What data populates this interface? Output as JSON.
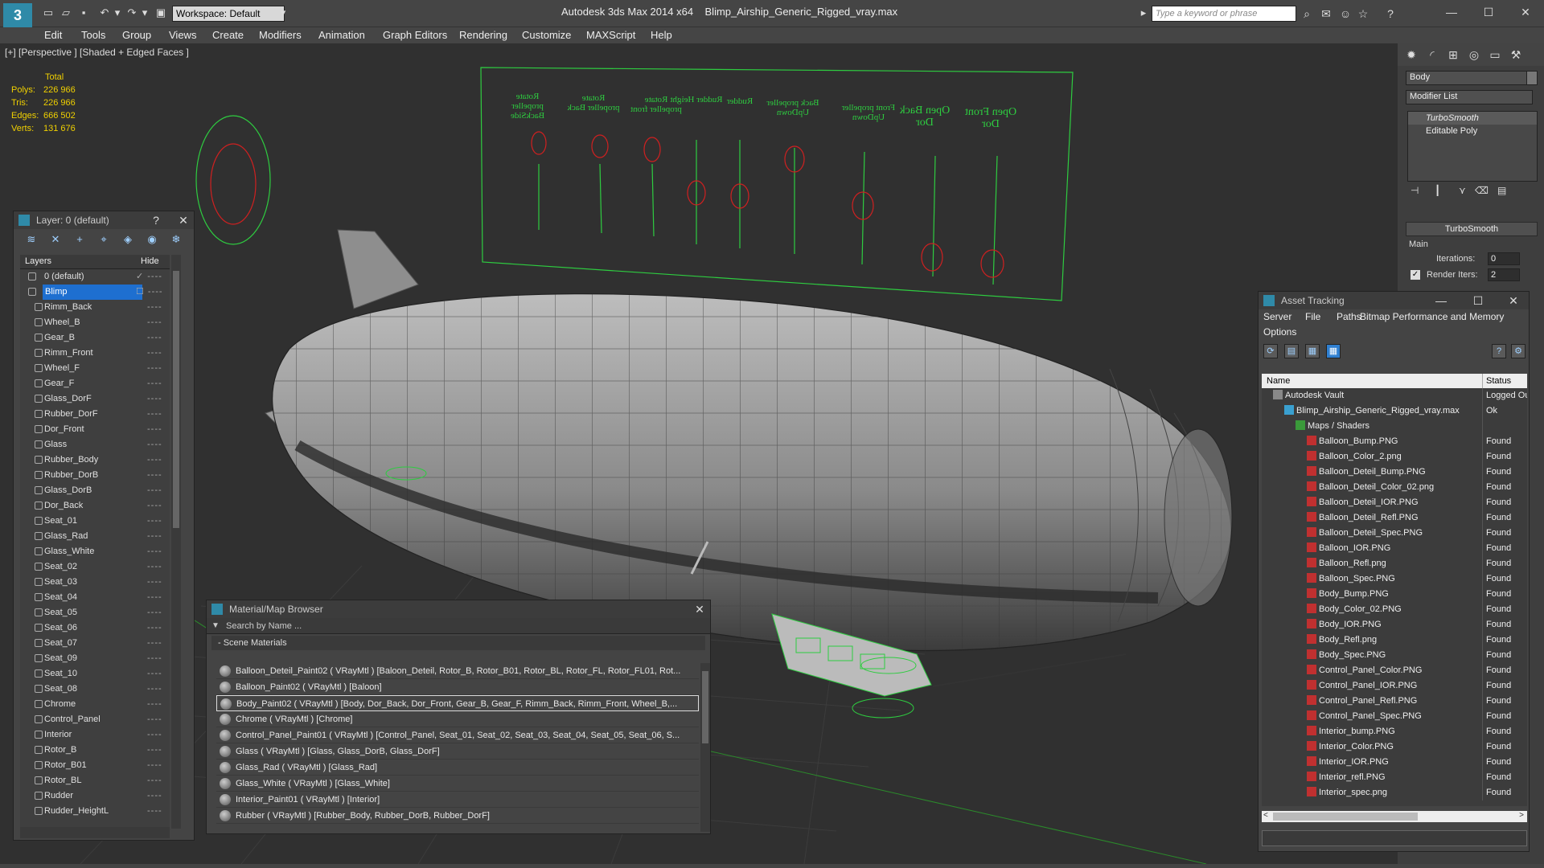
{
  "app": {
    "title": "Autodesk 3ds Max  2014 x64",
    "file": "Blimp_Airship_Generic_Rigged_vray.max",
    "workspace": "Workspace: Default",
    "search_placeholder": "Type a keyword or phrase",
    "logo": "3"
  },
  "menu": [
    "Edit",
    "Tools",
    "Group",
    "Views",
    "Create",
    "Modifiers",
    "Animation",
    "Graph Editors",
    "Rendering",
    "Customize",
    "MAXScript",
    "Help"
  ],
  "viewport": {
    "label": "[+] [Perspective ] [Shaded + Edged Faces ]",
    "stats": {
      "header": "Total",
      "rows": [
        {
          "label": "Polys:",
          "value": "226 966"
        },
        {
          "label": "Tris:",
          "value": "226 966"
        },
        {
          "label": "Edges:",
          "value": "666 502"
        },
        {
          "label": "Verts:",
          "value": "131 676"
        }
      ]
    },
    "control_labels": [
      "Rotate propeller BackSide",
      "Rotate propeller Back",
      "Rotate propeller front",
      "Rudder Height",
      "Rudder",
      "Back propeller UpDown",
      "Front propeller UpDown",
      "Open Back Dor",
      "Open Front Dor"
    ]
  },
  "layer_panel": {
    "title": "Layer: 0 (default)",
    "help": "?",
    "close": "✕",
    "col_layers": "Layers",
    "col_hide": "Hide",
    "rows": [
      {
        "name": "0 (default)",
        "top": true
      },
      {
        "name": "Blimp",
        "selected": true
      },
      {
        "name": "Rimm_Back"
      },
      {
        "name": "Wheel_B"
      },
      {
        "name": "Gear_B"
      },
      {
        "name": "Rimm_Front"
      },
      {
        "name": "Wheel_F"
      },
      {
        "name": "Gear_F"
      },
      {
        "name": "Glass_DorF"
      },
      {
        "name": "Rubber_DorF"
      },
      {
        "name": "Dor_Front"
      },
      {
        "name": "Glass"
      },
      {
        "name": "Rubber_Body"
      },
      {
        "name": "Rubber_DorB"
      },
      {
        "name": "Glass_DorB"
      },
      {
        "name": "Dor_Back"
      },
      {
        "name": "Seat_01"
      },
      {
        "name": "Glass_Rad"
      },
      {
        "name": "Glass_White"
      },
      {
        "name": "Seat_02"
      },
      {
        "name": "Seat_03"
      },
      {
        "name": "Seat_04"
      },
      {
        "name": "Seat_05"
      },
      {
        "name": "Seat_06"
      },
      {
        "name": "Seat_07"
      },
      {
        "name": "Seat_09"
      },
      {
        "name": "Seat_10"
      },
      {
        "name": "Seat_08"
      },
      {
        "name": "Chrome"
      },
      {
        "name": "Control_Panel"
      },
      {
        "name": "Interior"
      },
      {
        "name": "Rotor_B"
      },
      {
        "name": "Rotor_B01"
      },
      {
        "name": "Rotor_BL"
      },
      {
        "name": "Rudder"
      },
      {
        "name": "Rudder_HeightL"
      }
    ]
  },
  "material_browser": {
    "title": "Material/Map Browser",
    "close": "✕",
    "search_placeholder": "Search by Name ...",
    "group": "- Scene Materials",
    "items": [
      {
        "text": "Balloon_Deteil_Paint02 ( VRayMtl ) [Baloon_Deteil, Rotor_B, Rotor_B01, Rotor_BL, Rotor_FL, Rotor_FL01, Rot..."
      },
      {
        "text": "Balloon_Paint02 ( VRayMtl ) [Baloon]"
      },
      {
        "text": "Body_Paint02 ( VRayMtl ) [Body, Dor_Back, Dor_Front, Gear_B, Gear_F, Rimm_Back, Rimm_Front, Wheel_B,...",
        "selected": true
      },
      {
        "text": "Chrome ( VRayMtl ) [Chrome]"
      },
      {
        "text": "Control_Panel_Paint01 ( VRayMtl ) [Control_Panel, Seat_01, Seat_02, Seat_03, Seat_04, Seat_05, Seat_06, S..."
      },
      {
        "text": "Glass ( VRayMtl ) [Glass, Glass_DorB, Glass_DorF]"
      },
      {
        "text": "Glass_Rad ( VRayMtl ) [Glass_Rad]"
      },
      {
        "text": "Glass_White ( VRayMtl ) [Glass_White]"
      },
      {
        "text": "Interior_Paint01 ( VRayMtl ) [Interior]"
      },
      {
        "text": "Rubber ( VRayMtl ) [Rubber_Body, Rubber_DorB, Rubber_DorF]"
      }
    ]
  },
  "command_panel": {
    "object_name": "Body",
    "modifier_list": "Modifier List",
    "stack": [
      "TurboSmooth",
      "Editable Poly"
    ],
    "rollout": "TurboSmooth",
    "group": "Main",
    "iterations_label": "Iterations:",
    "iterations_value": "0",
    "render_iters_label": "Render Iters:",
    "render_iters_value": "2"
  },
  "asset_tracking": {
    "title": "Asset Tracking",
    "menu": [
      "Server",
      "File",
      "Paths",
      "Bitmap Performance and Memory",
      "Options"
    ],
    "col_name": "Name",
    "col_status": "Status",
    "rows": [
      {
        "name": "Autodesk Vault",
        "status": "Logged Out",
        "level": 1,
        "icon": "vault"
      },
      {
        "name": "Blimp_Airship_Generic_Rigged_vray.max",
        "status": "Ok",
        "level": 2,
        "icon": "max"
      },
      {
        "name": "Maps / Shaders",
        "status": "",
        "level": 3,
        "icon": "folder"
      },
      {
        "name": "Balloon_Bump.PNG",
        "status": "Found",
        "level": 4,
        "icon": "png"
      },
      {
        "name": "Balloon_Color_2.png",
        "status": "Found",
        "level": 4,
        "icon": "png"
      },
      {
        "name": "Balloon_Deteil_Bump.PNG",
        "status": "Found",
        "level": 4,
        "icon": "png"
      },
      {
        "name": "Balloon_Deteil_Color_02.png",
        "status": "Found",
        "level": 4,
        "icon": "png"
      },
      {
        "name": "Balloon_Deteil_IOR.PNG",
        "status": "Found",
        "level": 4,
        "icon": "png"
      },
      {
        "name": "Balloon_Deteil_Refl.PNG",
        "status": "Found",
        "level": 4,
        "icon": "png"
      },
      {
        "name": "Balloon_Deteil_Spec.PNG",
        "status": "Found",
        "level": 4,
        "icon": "png"
      },
      {
        "name": "Balloon_IOR.PNG",
        "status": "Found",
        "level": 4,
        "icon": "png"
      },
      {
        "name": "Balloon_Refl.png",
        "status": "Found",
        "level": 4,
        "icon": "png"
      },
      {
        "name": "Balloon_Spec.PNG",
        "status": "Found",
        "level": 4,
        "icon": "png"
      },
      {
        "name": "Body_Bump.PNG",
        "status": "Found",
        "level": 4,
        "icon": "png"
      },
      {
        "name": "Body_Color_02.PNG",
        "status": "Found",
        "level": 4,
        "icon": "png"
      },
      {
        "name": "Body_IOR.PNG",
        "status": "Found",
        "level": 4,
        "icon": "png"
      },
      {
        "name": "Body_Refl.png",
        "status": "Found",
        "level": 4,
        "icon": "png"
      },
      {
        "name": "Body_Spec.PNG",
        "status": "Found",
        "level": 4,
        "icon": "png"
      },
      {
        "name": "Control_Panel_Color.PNG",
        "status": "Found",
        "level": 4,
        "icon": "png"
      },
      {
        "name": "Control_Panel_IOR.PNG",
        "status": "Found",
        "level": 4,
        "icon": "png"
      },
      {
        "name": "Control_Panel_Refl.PNG",
        "status": "Found",
        "level": 4,
        "icon": "png"
      },
      {
        "name": "Control_Panel_Spec.PNG",
        "status": "Found",
        "level": 4,
        "icon": "png"
      },
      {
        "name": "Interior_bump.PNG",
        "status": "Found",
        "level": 4,
        "icon": "png"
      },
      {
        "name": "Interior_Color.PNG",
        "status": "Found",
        "level": 4,
        "icon": "png"
      },
      {
        "name": "Interior_IOR.PNG",
        "status": "Found",
        "level": 4,
        "icon": "png"
      },
      {
        "name": "Interior_refl.PNG",
        "status": "Found",
        "level": 4,
        "icon": "png"
      },
      {
        "name": "Interior_spec.png",
        "status": "Found",
        "level": 4,
        "icon": "png"
      }
    ]
  },
  "colors": {
    "accent": "#1e6fd0",
    "wire": "#2ecc40",
    "control_red": "#d02020",
    "stats": "#f0d000"
  }
}
